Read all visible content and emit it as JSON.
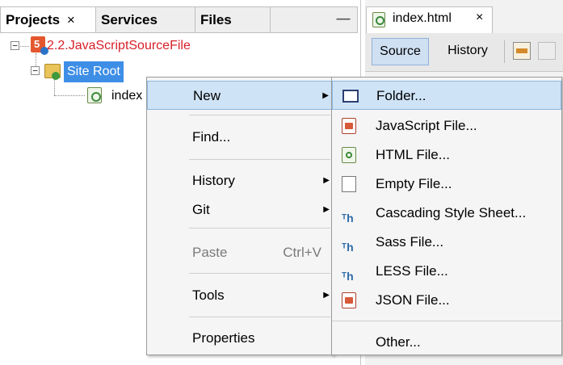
{
  "projects_panel": {
    "tabs": [
      {
        "label": "Projects",
        "close": "×"
      },
      {
        "label": "Services"
      },
      {
        "label": "Files"
      }
    ],
    "minimize": "—",
    "tree": {
      "project": "2.2.JavaScriptSourceFile",
      "site_root": "Site Root",
      "child": "index"
    }
  },
  "editor": {
    "tab_label": "index.html",
    "tab_close": "×",
    "source_button": "Source",
    "history_button": "History"
  },
  "context_menu": {
    "items": [
      {
        "label": "New",
        "submenu": true
      },
      {
        "label": "Find..."
      },
      {
        "label": "History",
        "submenu": true
      },
      {
        "label": "Git",
        "submenu": true
      },
      {
        "label": "Paste",
        "shortcut": "Ctrl+V",
        "disabled": true
      },
      {
        "label": "Tools",
        "submenu": true
      },
      {
        "label": "Properties"
      }
    ]
  },
  "new_submenu": {
    "items": [
      {
        "label": "Folder...",
        "icon": "folder-icon"
      },
      {
        "label": "JavaScript File...",
        "icon": "javascript-file-icon"
      },
      {
        "label": "HTML File...",
        "icon": "html-file-icon"
      },
      {
        "label": "Empty File...",
        "icon": "empty-file-icon"
      },
      {
        "label": "Cascading Style Sheet...",
        "icon": "css-file-icon"
      },
      {
        "label": "Sass File...",
        "icon": "sass-file-icon"
      },
      {
        "label": "LESS File...",
        "icon": "less-file-icon"
      },
      {
        "label": "JSON File...",
        "icon": "json-file-icon"
      },
      {
        "label": "Other..."
      }
    ]
  },
  "colors": {
    "selection": "#3e8ee6",
    "menu_highlight": "#cfe3f7",
    "project_text": "#d8202a"
  }
}
